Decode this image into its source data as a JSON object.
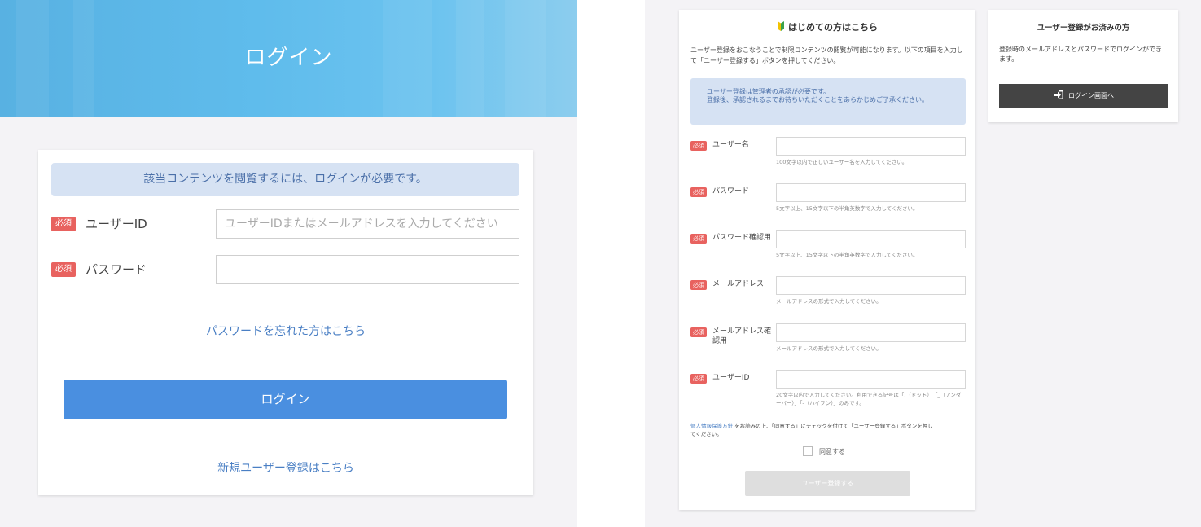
{
  "login_page": {
    "hero_title": "ログイン",
    "notice": "該当コンテンツを閲覧するには、ログインが必要です。",
    "required_badge": "必須",
    "user_id": {
      "label": "ユーザーID",
      "placeholder": "ユーザーIDまたはメールアドレスを入力してください"
    },
    "password": {
      "label": "パスワード",
      "placeholder": ""
    },
    "forgot_link": "パスワードを忘れた方はこちら",
    "login_button": "ログイン",
    "register_link": "新規ユーザー登録はこちら"
  },
  "registration": {
    "title": "はじめての方はこちら",
    "intro": "ユーザー登録をおこなうことで制限コンテンツの閲覧が可能になります。以下の項目を入力して「ユーザー登録する」ボタンを押してください。",
    "notice_line1": "ユーザー登録は管理者の承認が必要です。",
    "notice_line2": "登録後、承認されるまでお待ちいただくことをあらかじめご了承ください。",
    "required_badge": "必須",
    "fields": [
      {
        "label": "ユーザー名",
        "hint": "100文字以内で正しいユーザー名を入力してください。"
      },
      {
        "label": "パスワード",
        "hint": "5文字以上、15文字以下の半角英数字で入力してください。"
      },
      {
        "label": "パスワード確認用",
        "hint": "5文字以上、15文字以下の半角英数字で入力してください。"
      },
      {
        "label": "メールアドレス",
        "hint": "メールアドレスの形式で入力してください。"
      },
      {
        "label": "メールアドレス確認用",
        "hint": "メールアドレスの形式で入力してください。"
      },
      {
        "label": "ユーザーID",
        "hint": "20文字以内で入力してください。利用できる記号は「.（ドット）」「_（アンダーバー）」「-（ハイフン）」のみです。"
      }
    ],
    "privacy_link": "個人情報保護方針",
    "privacy_text": "をお読みの上、「同意する」にチェックを付けて「ユーザー登録する」ボタンを押してください。",
    "agree_label": "同意する",
    "submit_button": "ユーザー登録する"
  },
  "existing_user": {
    "title": "ユーザー登録がお済みの方",
    "text": "登録時のメールアドレスとパスワードでログインができます。",
    "button": "ログイン画面へ"
  },
  "colors": {
    "hero_blue": "#5fbcec",
    "primary_button": "#4a8fe0",
    "required_badge": "#e8625f",
    "notice_bg": "#d6e2f3",
    "link": "#4a7fc4",
    "dark_button": "#444444"
  }
}
